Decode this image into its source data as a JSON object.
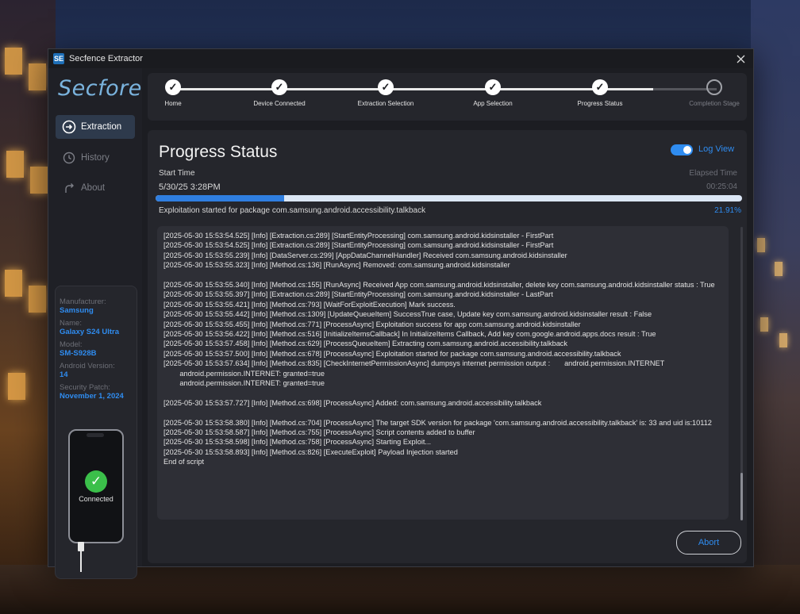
{
  "window": {
    "title": "Secfence Extractor",
    "icon_text": "SE"
  },
  "sidebar": {
    "brand": "Secfore",
    "items": [
      {
        "label": "Extraction",
        "icon": "arrow-circle-icon",
        "active": true
      },
      {
        "label": "History",
        "icon": "clock-icon",
        "active": false
      },
      {
        "label": "About",
        "icon": "info-arrow-icon",
        "active": false
      }
    ]
  },
  "device": {
    "manufacturer_label": "Manufacturer:",
    "manufacturer": "Samsung",
    "name_label": "Name:",
    "name": "Galaxy S24 Ultra",
    "model_label": "Model:",
    "model": "SM-S928B",
    "android_label": "Android Version:",
    "android": "14",
    "patch_label": "Security Patch:",
    "patch": "November 1, 2024",
    "status": "Connected"
  },
  "steps": [
    {
      "label": "Home",
      "done": true
    },
    {
      "label": "Device Connected",
      "done": true
    },
    {
      "label": "Extraction Selection",
      "done": true
    },
    {
      "label": "App Selection",
      "done": true
    },
    {
      "label": "Progress Status",
      "done": true
    },
    {
      "label": "Completion Stage",
      "done": false
    }
  ],
  "main": {
    "title": "Progress Status",
    "log_view_label": "Log View",
    "log_view_on": true,
    "start_time_label": "Start Time",
    "start_time": "5/30/25 3:28PM",
    "elapsed_label": "Elapsed Time",
    "elapsed": "00:25:04",
    "progress_fraction": 0.2191,
    "status": "Exploitation started for package com.samsung.android.accessibility.talkback",
    "percent": "21.91%",
    "abort_label": "Abort"
  },
  "log_lines": [
    "[2025-05-30 15:53:54.525] [Info] [Extraction.cs:289] [StartEntityProcessing] com.samsung.android.kidsinstaller - FirstPart",
    "[2025-05-30 15:53:54.525] [Info] [Extraction.cs:289] [StartEntityProcessing] com.samsung.android.kidsinstaller - FirstPart",
    "[2025-05-30 15:53:55.239] [Info] [DataServer.cs:299] [AppDataChannelHandler] Received com.samsung.android.kidsinstaller",
    "[2025-05-30 15:53:55.323] [Info] [Method.cs:136] [RunAsync] Removed: com.samsung.android.kidsinstaller",
    "",
    "[2025-05-30 15:53:55.340] [Info] [Method.cs:155] [RunAsync] Received App com.samsung.android.kidsinstaller, delete key com.samsung.android.kidsinstaller status : True",
    "[2025-05-30 15:53:55.397] [Info] [Extraction.cs:289] [StartEntityProcessing] com.samsung.android.kidsinstaller - LastPart",
    "[2025-05-30 15:53:55.421] [Info] [Method.cs:793] [WaitForExploitExecution] Mark success.",
    "[2025-05-30 15:53:55.442] [Info] [Method.cs:1309] [UpdateQueueItem] SuccessTrue case, Update key com.samsung.android.kidsinstaller result : False",
    "[2025-05-30 15:53:55.455] [Info] [Method.cs:771] [ProcessAsync] Exploitation success for app com.samsung.android.kidsinstaller",
    "[2025-05-30 15:53:56.422] [Info] [Method.cs:516] [InitializeItemsCallback] In InitializeItems Callback, Add key com.google.android.apps.docs result : True",
    "[2025-05-30 15:53:57.458] [Info] [Method.cs:629] [ProcessQueueItem] Extracting com.samsung.android.accessibility.talkback",
    "[2025-05-30 15:53:57.500] [Info] [Method.cs:678] [ProcessAsync] Exploitation started for package com.samsung.android.accessibility.talkback",
    "[2025-05-30 15:53:57.634] [Info] [Method.cs:835] [CheckInternetPermissionAsync] dumpsys internet permission output :       android.permission.INTERNET",
    "        android.permission.INTERNET: granted=true",
    "        android.permission.INTERNET: granted=true",
    "",
    "[2025-05-30 15:53:57.727] [Info] [Method.cs:698] [ProcessAsync] Added: com.samsung.android.accessibility.talkback",
    "",
    "[2025-05-30 15:53:58.380] [Info] [Method.cs:704] [ProcessAsync] The target SDK version for package 'com.samsung.android.accessibility.talkback' is: 33 and uid is:10112",
    "[2025-05-30 15:53:58.587] [Info] [Method.cs:755] [ProcessAsync] Script contents added to buffer",
    "[2025-05-30 15:53:58.598] [Info] [Method.cs:758] [ProcessAsync] Starting Exploit...",
    "[2025-05-30 15:53:58.893] [Info] [Method.cs:826] [ExecuteExploit] Payload Injection started",
    "End of script"
  ]
}
